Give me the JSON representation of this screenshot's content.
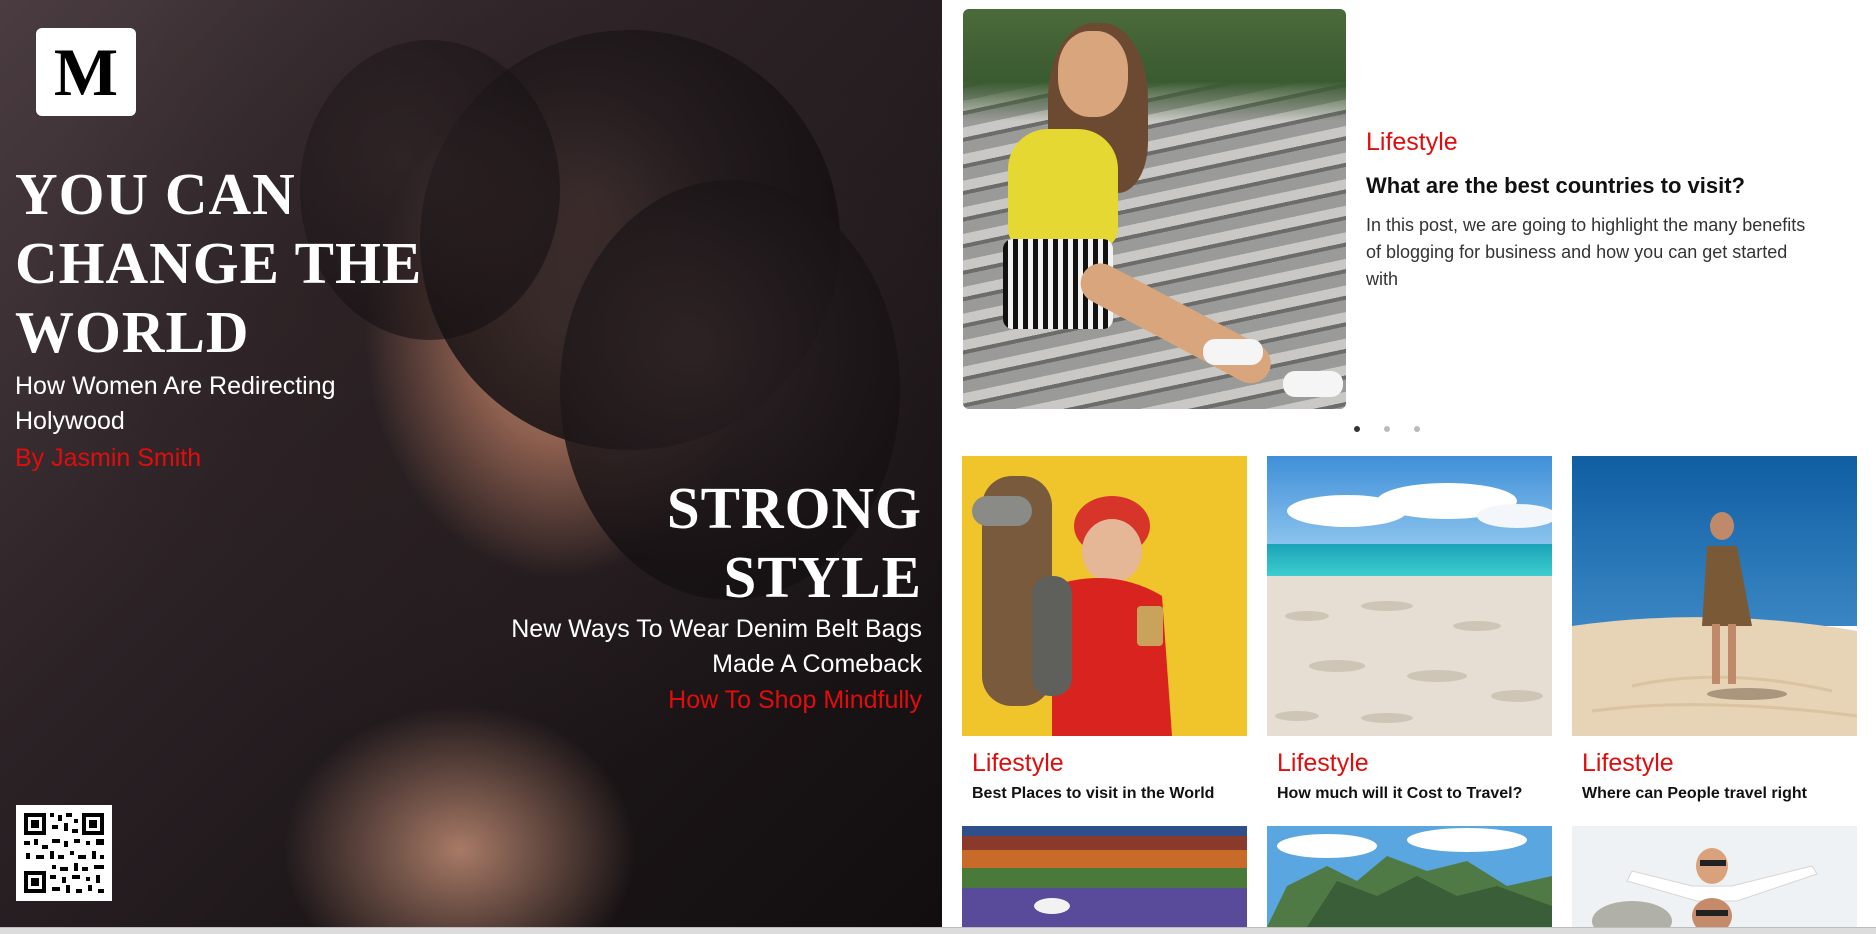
{
  "hero": {
    "logo_letter": "M",
    "headline_1": "YOU CAN CHANGE THE WORLD",
    "subheadline_1": "How Women Are Redirecting Holywood",
    "byline_1": "By Jasmin Smith",
    "headline_2": "STRONG STYLE",
    "subheadline_2": "New Ways To Wear Denim Belt Bags Made A Comeback",
    "byline_2": "How To Shop Mindfully"
  },
  "featured": {
    "category": "Lifestyle",
    "title": "What are the best countries to visit?",
    "excerpt": "In this post, we are going to highlight the many benefits of blogging for business and how you can get started with",
    "slide_count": 3,
    "active_slide": 1
  },
  "cards": [
    {
      "category": "Lifestyle",
      "title": "Best Places to visit in the World"
    },
    {
      "category": "Lifestyle",
      "title": "How much will it Cost to Travel?"
    },
    {
      "category": "Lifestyle",
      "title": "Where can People travel right"
    }
  ],
  "colors": {
    "accent_red": "#e10d0d",
    "hero_bg": "#1a1416",
    "text_dark": "#111111"
  },
  "icons": [
    "logo-m",
    "qr-code-icon"
  ]
}
